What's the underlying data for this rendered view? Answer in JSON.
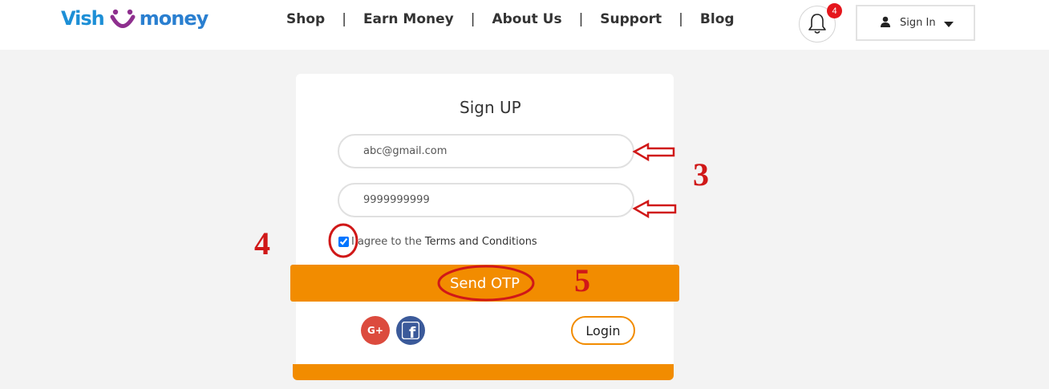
{
  "header": {
    "logo": {
      "part1": "Vish",
      "part2": "money",
      "smile_color": "#8e2f8e",
      "text_color": "#1d8fd6"
    },
    "nav": [
      "Shop",
      "Earn Money",
      "About Us",
      "Support",
      "Blog"
    ],
    "nav_separator": "|",
    "notifications": {
      "icon": "bell-icon",
      "count": "4"
    },
    "signin": {
      "label": "Sign In",
      "icon": "user-icon",
      "caret": "caret-down-icon"
    }
  },
  "form": {
    "title": "Sign UP",
    "email": {
      "value": "abc@gmail.com"
    },
    "phone": {
      "value": "9999999999"
    },
    "terms": {
      "prefix": "I agree to the",
      "link": "Terms and Conditions",
      "checked": true
    },
    "send_otp": "Send OTP",
    "social": {
      "google": "G+",
      "facebook": "f"
    },
    "login": "Login",
    "accent_color": "#f28c00"
  },
  "annotations": {
    "labels": [
      "3",
      "4",
      "5"
    ],
    "color": "#d01818"
  }
}
